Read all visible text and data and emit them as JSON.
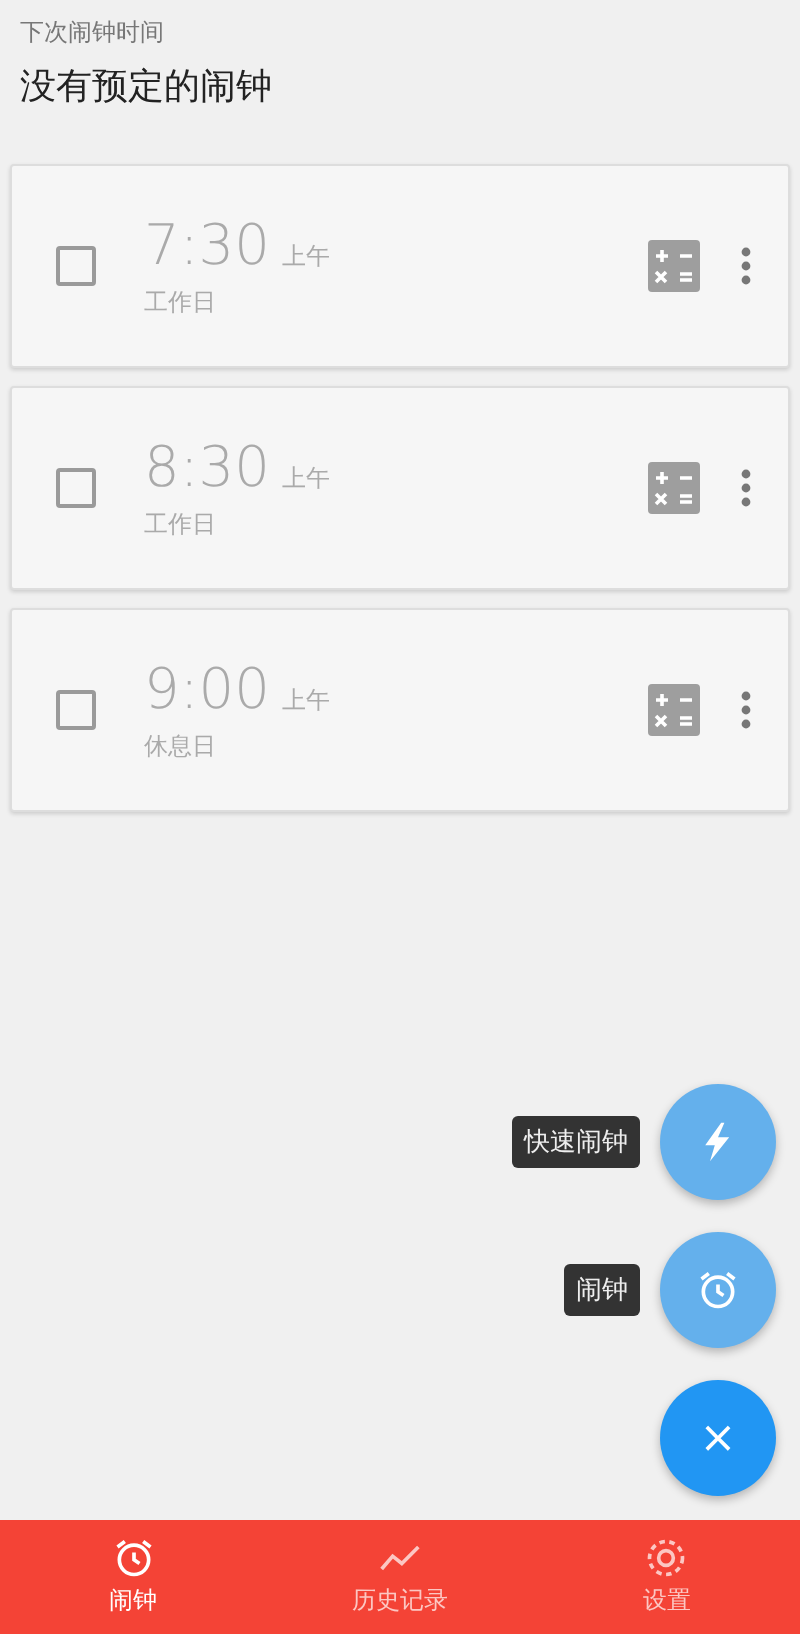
{
  "header": {
    "caption": "下次闹钟时间",
    "title": "没有预定的闹钟"
  },
  "alarms": [
    {
      "time": "7:30",
      "period": "上午",
      "repeat": "工作日",
      "enabled": false
    },
    {
      "time": "8:30",
      "period": "上午",
      "repeat": "工作日",
      "enabled": false
    },
    {
      "time": "9:00",
      "period": "上午",
      "repeat": "休息日",
      "enabled": false
    }
  ],
  "fab_menu": [
    {
      "kind": "quick",
      "label": "快速闹钟"
    },
    {
      "kind": "alarm",
      "label": "闹钟"
    }
  ],
  "fab_close": "×",
  "tabs": [
    {
      "kind": "alarm",
      "label": "闹钟",
      "selected": true
    },
    {
      "kind": "history",
      "label": "历史记录",
      "selected": false
    },
    {
      "kind": "settings",
      "label": "设置",
      "selected": false
    }
  ]
}
